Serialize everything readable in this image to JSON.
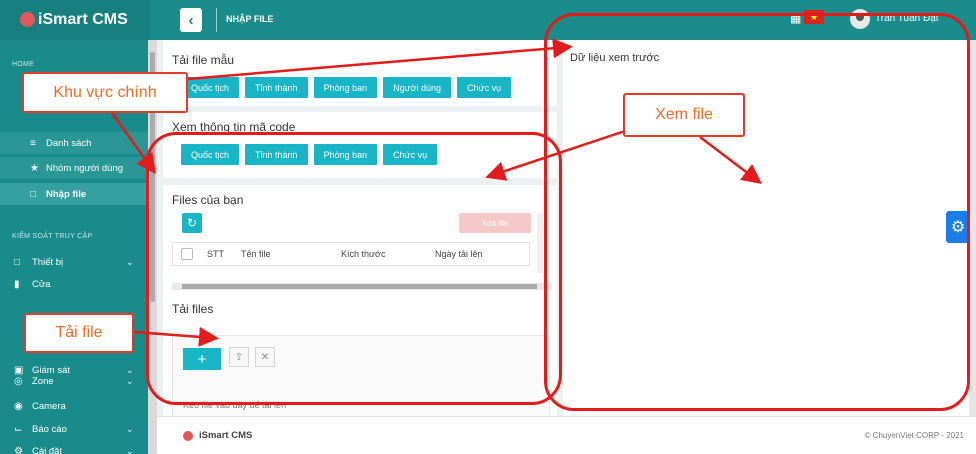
{
  "header": {
    "brand": "iSmart CMS",
    "back_icon": "chevron-left-icon",
    "page_title": "NHẬP FILE",
    "grid_icon": "grid-icon",
    "flag": "flag-vietnam-icon",
    "user_name": "Tran Tuan Đạt"
  },
  "sidebar": {
    "home_label": "HOME",
    "items_top": [
      {
        "label": "Danh sách",
        "icon": "list-icon"
      },
      {
        "label": "Nhóm người dùng",
        "icon": "users-icon"
      },
      {
        "label": "Nhập file",
        "icon": "file-icon",
        "active": true
      }
    ],
    "access_label": "KIỂM SOÁT TRUY CẬP",
    "items": [
      {
        "label": "Thiết bị",
        "icon": "device-icon",
        "chevron": true
      },
      {
        "label": "Cửa",
        "icon": "door-icon",
        "chevron": false
      },
      {
        "label": "Giám sát",
        "icon": "monitor-icon",
        "chevron": true
      },
      {
        "label": "Zone",
        "icon": "zone-icon",
        "chevron": true
      },
      {
        "label": "Camera",
        "icon": "camera-icon",
        "chevron": false
      },
      {
        "label": "Báo cáo",
        "icon": "chart-icon",
        "chevron": true
      },
      {
        "label": "Cài đặt",
        "icon": "settings-icon",
        "chevron": true
      }
    ]
  },
  "template": {
    "title": "Tải file mẫu",
    "buttons": [
      "Quốc tịch",
      "Tỉnh thành",
      "Phòng ban",
      "Người dùng",
      "Chức vụ"
    ]
  },
  "code_info": {
    "title": "Xem thông tin mã code",
    "buttons": [
      "Quốc tịch",
      "Tỉnh thành",
      "Phòng ban",
      "Chức vụ"
    ]
  },
  "files": {
    "title": "Files của bạn",
    "delete_label": "Xoá file",
    "columns": [
      "STT",
      "Tên file",
      "Kích thước",
      "Ngày tải lên"
    ]
  },
  "upload": {
    "title": "Tải files",
    "add_icon": "plus-icon",
    "upload_icon": "upload-icon",
    "cancel_icon": "close-icon",
    "drop_text": "Kéo file vào đây để tải lên"
  },
  "preview": {
    "title": "Dữ liệu xem trước"
  },
  "footer": {
    "brand": "iSmart CMS",
    "copyright": "© ChuyenViet CORP - 2021"
  },
  "annotations": {
    "main_area": "Khu vực chính",
    "view_file": "Xem file",
    "upload_file": "Tải file",
    "color": "#e31b1b"
  }
}
